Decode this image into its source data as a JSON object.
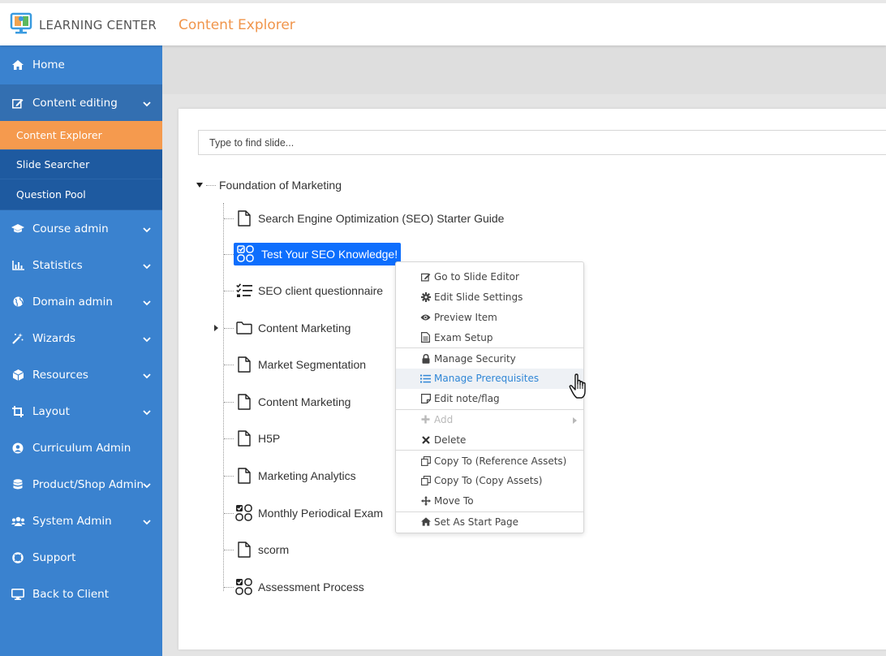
{
  "app": {
    "brand": "LEARNING CENTER",
    "page_title": "Content Explorer",
    "accent": "#f0954b",
    "sidebar_color": "#3a82cf",
    "selection_color": "#0d6efd"
  },
  "sidebar": {
    "items": [
      {
        "label": "Home",
        "icon": "home-icon"
      },
      {
        "label": "Content editing",
        "icon": "edit-icon",
        "expandable": true,
        "expanded": true
      },
      {
        "label": "Course admin",
        "icon": "graduation-cap-icon",
        "expandable": true
      },
      {
        "label": "Statistics",
        "icon": "bar-chart-icon",
        "expandable": true
      },
      {
        "label": "Domain admin",
        "icon": "globe-icon",
        "expandable": true
      },
      {
        "label": "Wizards",
        "icon": "magic-wand-icon",
        "expandable": true
      },
      {
        "label": "Resources",
        "icon": "cube-icon",
        "expandable": true
      },
      {
        "label": "Layout",
        "icon": "crop-icon",
        "expandable": true
      },
      {
        "label": "Curriculum Admin",
        "icon": "user-circle-icon"
      },
      {
        "label": "Product/Shop Admin",
        "icon": "database-icon",
        "expandable": true
      },
      {
        "label": "System Admin",
        "icon": "users-icon",
        "expandable": true
      },
      {
        "label": "Support",
        "icon": "life-ring-icon"
      },
      {
        "label": "Back to Client",
        "icon": "monitor-icon"
      }
    ],
    "subitems": [
      {
        "label": "Content Explorer",
        "current": true
      },
      {
        "label": "Slide Searcher"
      },
      {
        "label": "Question Pool"
      }
    ]
  },
  "search": {
    "placeholder": "Type to find slide..."
  },
  "tree": {
    "root": "Foundation of Marketing",
    "children": [
      {
        "label": "Search Engine Optimization (SEO) Starter Guide",
        "icon": "page-icon"
      },
      {
        "label": "Test Your SEO Knowledge!",
        "icon": "exam-icon",
        "selected": true
      },
      {
        "label": "SEO client questionnaire",
        "icon": "checklist-icon"
      },
      {
        "label": "Content Marketing",
        "icon": "folder-icon",
        "collapsed": true
      },
      {
        "label": "Market Segmentation",
        "icon": "page-icon"
      },
      {
        "label": "Content Marketing",
        "icon": "page-icon"
      },
      {
        "label": "H5P",
        "icon": "page-icon"
      },
      {
        "label": "Marketing Analytics",
        "icon": "page-icon"
      },
      {
        "label": "Monthly Periodical Exam",
        "icon": "exam-icon"
      },
      {
        "label": "scorm",
        "icon": "page-icon"
      },
      {
        "label": "Assessment Process",
        "icon": "exam-icon"
      }
    ]
  },
  "context_menu": {
    "items": [
      {
        "label": "Go to Slide Editor",
        "icon": "edit-icon"
      },
      {
        "label": "Edit Slide Settings",
        "icon": "gear-icon"
      },
      {
        "label": "Preview Item",
        "icon": "eye-icon"
      },
      {
        "label": "Exam Setup",
        "icon": "document-icon"
      },
      {
        "label": "Manage Security",
        "icon": "lock-icon"
      },
      {
        "label": "Manage Prerequisites",
        "icon": "list-icon",
        "highlighted": true
      },
      {
        "label": "Edit note/flag",
        "icon": "note-icon"
      },
      {
        "label": "Add",
        "icon": "plus-icon",
        "disabled": true,
        "has_submenu": true
      },
      {
        "label": "Delete",
        "icon": "close-icon"
      },
      {
        "label": "Copy To (Reference Assets)",
        "icon": "copy-icon"
      },
      {
        "label": "Copy To (Copy Assets)",
        "icon": "copy-icon"
      },
      {
        "label": "Move To",
        "icon": "move-icon"
      },
      {
        "label": "Set As Start Page",
        "icon": "home-icon"
      }
    ]
  }
}
